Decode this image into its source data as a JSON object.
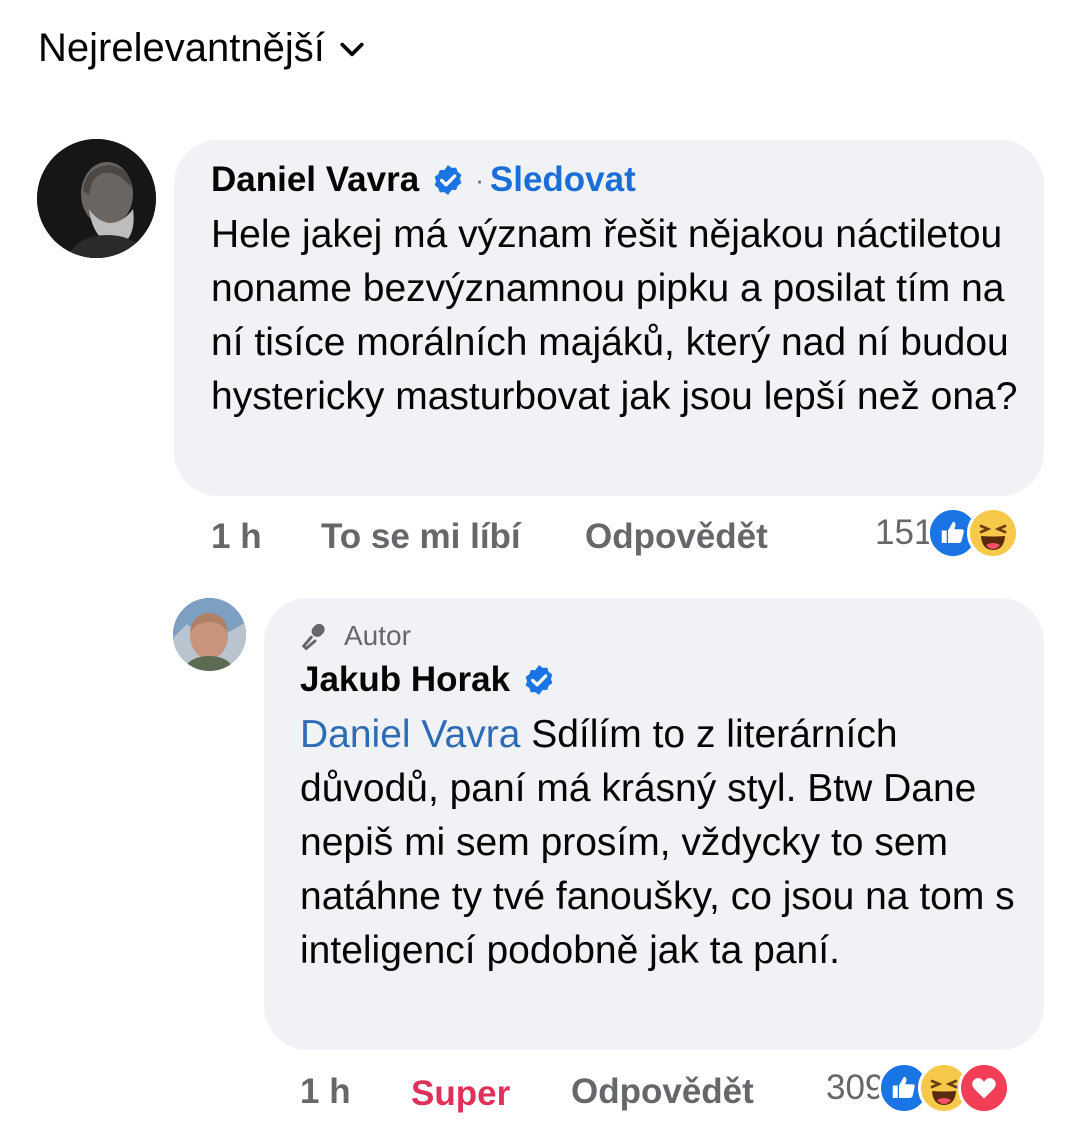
{
  "sort": {
    "label": "Nejrelevantnější",
    "icon": "chevron-down-icon"
  },
  "colors": {
    "accent": "#1a6ed8",
    "mention": "#2d6cb5",
    "super": "#e0315b",
    "bubble": "#f0f2f5",
    "muted": "#65676b"
  },
  "comments": [
    {
      "author": "Daniel Vavra",
      "verified": true,
      "follow_label": "Sledovat",
      "separator": "·",
      "text": "Hele jakej má význam řešit nějakou náctiletou noname bezvýznamnou pipku a posilat tím na ní tisíce morálních majáků, který nad ní budou hystericky masturbovat jak jsou lepší než ona?",
      "time": "1 h",
      "like_label": "To se mi líbí",
      "reply_label": "Odpovědět",
      "reaction_count": "151",
      "reactions": [
        "like-icon",
        "haha-icon"
      ]
    },
    {
      "badge": "Autor",
      "author": "Jakub Horak",
      "verified": true,
      "mention": "Daniel Vavra",
      "text": " Sdílím to z literárních důvodů, paní má krásný styl. Btw Dane nepiš mi sem prosím, vždycky to sem natáhne ty tvé fanoušky, co jsou na tom s inteligencí podobně jak ta paní.",
      "time": "1 h",
      "like_label": "Super",
      "reply_label": "Odpovědět",
      "reaction_count": "309",
      "reactions": [
        "like-icon",
        "haha-icon",
        "love-icon"
      ]
    }
  ]
}
